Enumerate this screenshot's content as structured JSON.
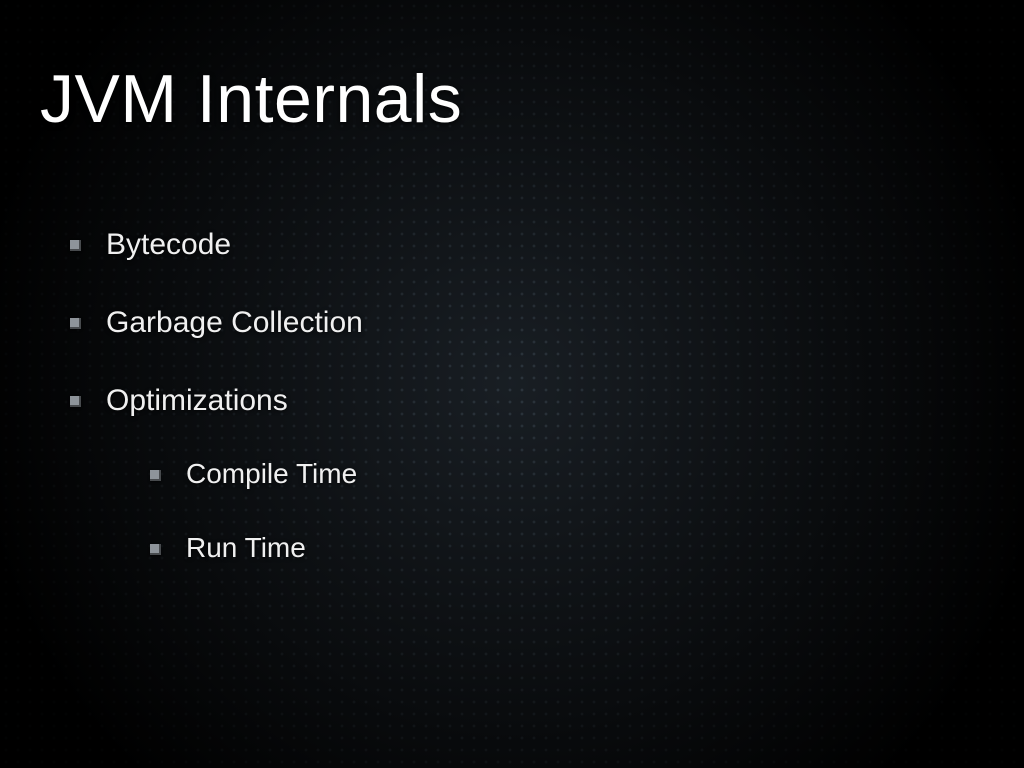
{
  "slide": {
    "title": "JVM Internals",
    "items": [
      {
        "label": "Bytecode"
      },
      {
        "label": "Garbage Collection"
      },
      {
        "label": "Optimizations",
        "children": [
          {
            "label": "Compile Time"
          },
          {
            "label": "Run Time"
          }
        ]
      }
    ]
  }
}
